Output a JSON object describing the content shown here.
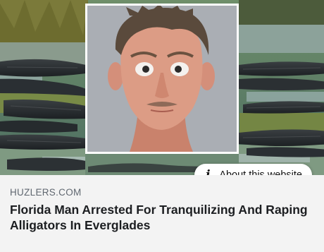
{
  "image": {
    "description_icon": "photo-icon"
  },
  "about_button": {
    "icon": "info-icon",
    "icon_glyph": "i",
    "label": "About this website"
  },
  "article": {
    "source": "HUZLERS.COM",
    "headline": "Florida Man Arrested For Tranquilizing And Raping Alligators In Everglades"
  },
  "colors": {
    "card_background": "#f3f3f3",
    "source_text": "#606770",
    "headline_text": "#1c1e21",
    "pill_background": "#ffffff"
  }
}
